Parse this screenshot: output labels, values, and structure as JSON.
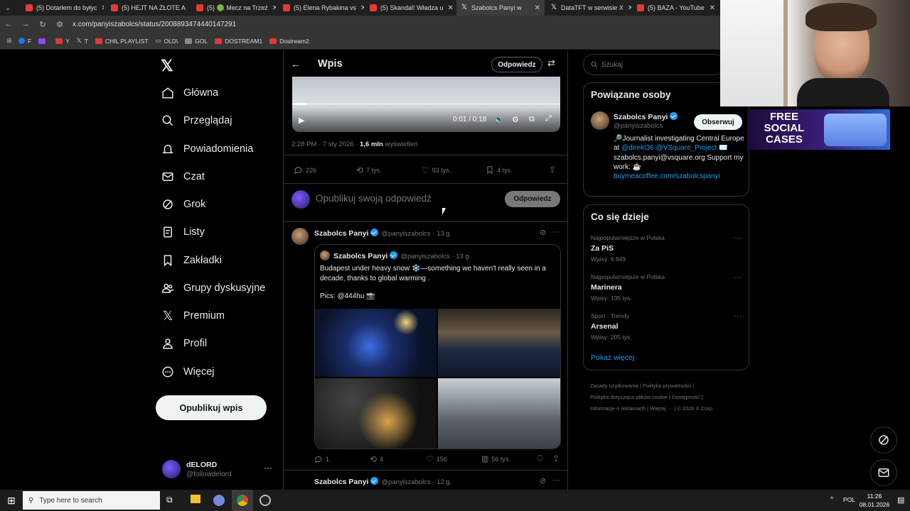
{
  "browser": {
    "tabs": [
      {
        "title": "(5) Dotarłem do byłyc"
      },
      {
        "title": "(5) HEJT NA ZŁOTE A"
      },
      {
        "title": "(5) 🟢 Mecz na Trzeź"
      },
      {
        "title": "(5) Elena Rybakina vs"
      },
      {
        "title": "(5) Skandal! Władza u"
      },
      {
        "title": "Szabolcs Panyi w"
      },
      {
        "title": "DataTFT w serwisie X"
      },
      {
        "title": "(5) BAZA - YouTube"
      }
    ],
    "url": "x.com/panyiszabolcs/status/2008893474440147291",
    "bookmarks": [
      "F",
      "Y",
      "T",
      "CHIL PLAYLIST",
      "OLD\\",
      "GOL",
      "DOSTREAM1",
      "Dostream2"
    ]
  },
  "nav": {
    "items": [
      {
        "label": "Główna"
      },
      {
        "label": "Przeglądaj"
      },
      {
        "label": "Powiadomienia"
      },
      {
        "label": "Czat"
      },
      {
        "label": "Grok"
      },
      {
        "label": "Listy"
      },
      {
        "label": "Zakładki"
      },
      {
        "label": "Grupy dyskusyjne"
      },
      {
        "label": "Premium"
      },
      {
        "label": "Profil"
      },
      {
        "label": "Więcej"
      }
    ],
    "post_button": "Opublikuj wpis",
    "account": {
      "name": "dELORD",
      "handle": "@followdelord"
    }
  },
  "header": {
    "title": "Wpis",
    "reply_button": "Odpowiedz"
  },
  "video": {
    "time": "0:01 / 0:18",
    "progress": 0.056
  },
  "post": {
    "timestamp": "2:28 PM · 7 sty 2026 · ",
    "views_count": "1,6 mln",
    "views_label": " wyświetleń",
    "replies": "226",
    "reposts": "7 tys.",
    "likes": "93 tys.",
    "bookmarks": "4 tys."
  },
  "compose": {
    "placeholder": "Opublikuj swoją odpowiedź",
    "button": "Odpowiedz"
  },
  "reply": {
    "author": "Szabolcs Panyi",
    "handle_time": "@panyiszabolcs · 13 g.",
    "quoted": {
      "author": "Szabolcs Panyi",
      "handle_time": "@panyiszabolcs · 13 g.",
      "text": "Budapest under heavy snow ❄️—something we haven't really seen in a decade, thanks to global warming .",
      "pics": "Pics: @444hu 📸"
    },
    "stats": {
      "replies": "1",
      "reposts": "4",
      "likes": "156",
      "views": "56 tys."
    }
  },
  "next_post": {
    "author": "Szabolcs Panyi",
    "handle_time": "@panyiszabolcs · 12 g."
  },
  "search": {
    "placeholder": "Szukaj"
  },
  "related": {
    "title": "Powiązane osoby",
    "name": "Szabolcs Panyi",
    "handle": "@panyiszabolcs",
    "follow": "Obserwuj",
    "bio_prefix": "🔎Journalist investigating Central Europe at ",
    "bio_link1": "@direkt36",
    "bio_link2": "@VSquare_Project",
    "bio_mid": " ✉️ szabolcs.panyi@vsquare.org Support my work: ☕",
    "bio_link3": "buymeacoffee.com/szabolcspanyi"
  },
  "trends": {
    "title": "Co się dzieje",
    "items": [
      {
        "meta": "Najpopularniejsze w Polska",
        "name": "Za PiS",
        "count": "Wpisy: 6 849"
      },
      {
        "meta": "Najpopularniejsze w Polska",
        "name": "Marinera",
        "count": "Wpisy: 135 tys."
      },
      {
        "meta": "Sport · Trendy",
        "name": "Arsenal",
        "count": "Wpisy: 205 tys."
      }
    ],
    "more": "Pokaż więcej"
  },
  "footer": {
    "row1": [
      "Zasady użytkowania",
      "Polityka prywatności"
    ],
    "row2": [
      "Polityka dotycząca plików cookie",
      "Dostępność"
    ],
    "row3": [
      "Informacje o reklamach",
      "Więcej ···",
      "© 2026 X Corp."
    ]
  },
  "overlay": {
    "ad_line1": "FREE",
    "ad_line2": "SOCIAL",
    "ad_line3": "CASES"
  },
  "taskbar": {
    "search": "Type here to search",
    "lang": "POL",
    "time": "11:26",
    "date": "08.01.2026"
  },
  "colors": {
    "accent": "#1d9bf0",
    "bg": "#000000",
    "border": "#2f3336"
  }
}
